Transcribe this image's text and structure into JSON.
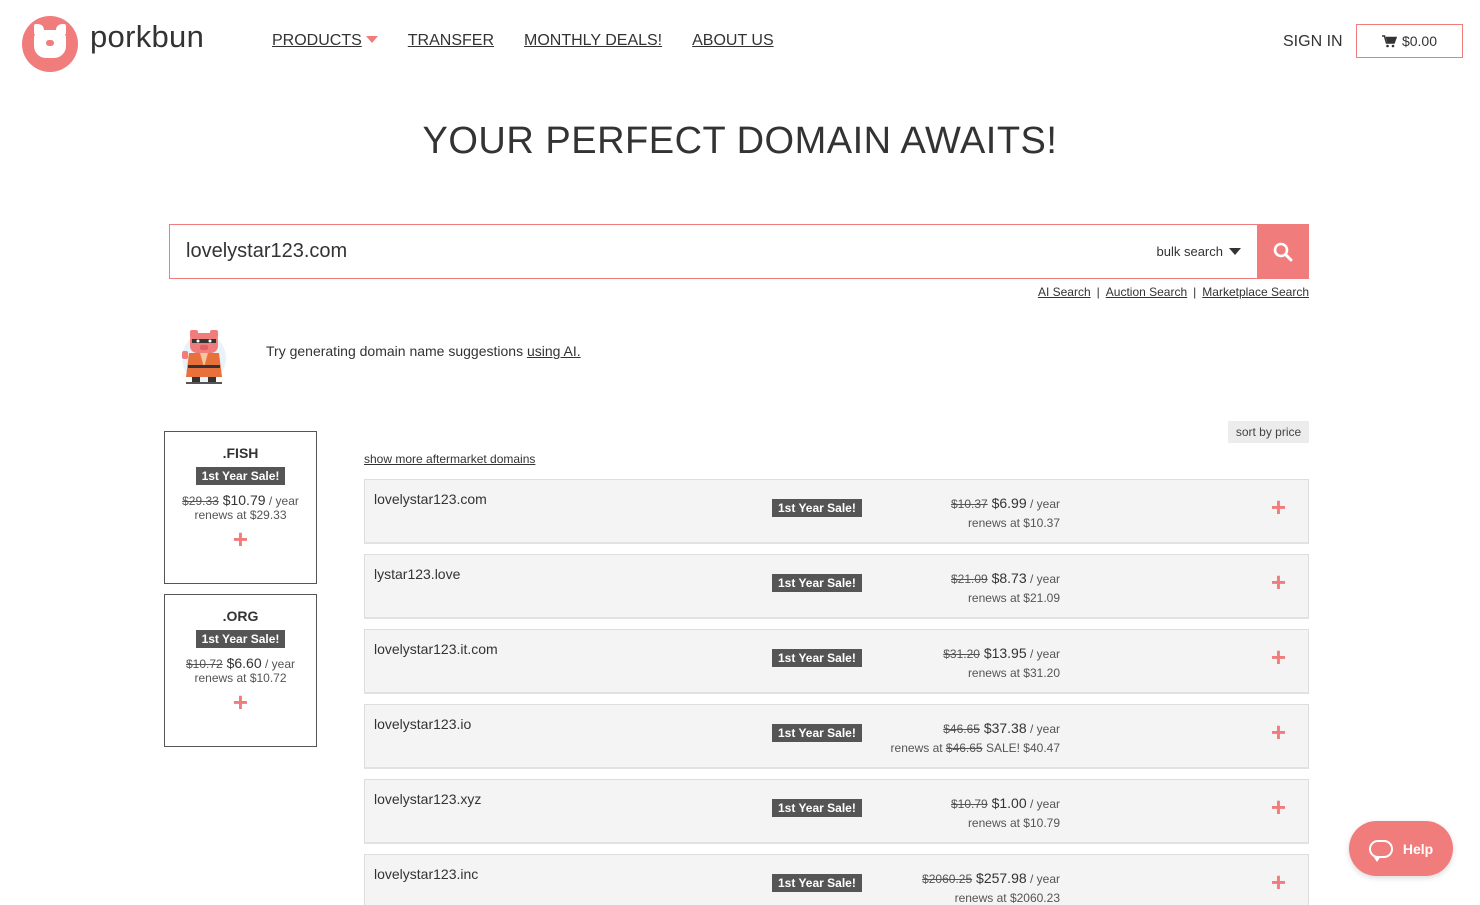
{
  "brand": {
    "name": "porkbun",
    "logo_icon": "pig-icon",
    "accent": "#f07c7c"
  },
  "nav": {
    "products": "PRODUCTS",
    "transfer": "TRANSFER",
    "deals": "MONTHLY DEALS!",
    "about": "ABOUT US"
  },
  "header": {
    "signin": "SIGN IN",
    "cart_total": "$0.00",
    "cart_icon": "cart-icon"
  },
  "hero": {
    "title": "YOUR PERFECT DOMAIN AWAITS!"
  },
  "search": {
    "value": "lovelystar123.com",
    "bulk_label": "bulk search",
    "search_icon": "search-icon"
  },
  "search_links": {
    "ai": "AI Search",
    "auction": "Auction Search",
    "marketplace": "Marketplace Search",
    "separator": "|"
  },
  "ai_suggest": {
    "text": "Try generating domain name suggestions ",
    "link": "using AI."
  },
  "side_cards": [
    {
      "tld": ".FISH",
      "badge": "1st Year Sale!",
      "old_price": "$29.33",
      "price": "$10.79",
      "per": " / year",
      "renew": "renews at $29.33",
      "add": "+"
    },
    {
      "tld": ".ORG",
      "badge": "1st Year Sale!",
      "old_price": "$10.72",
      "price": "$6.60",
      "per": " / year",
      "renew": "renews at $10.72",
      "add": "+"
    }
  ],
  "results": {
    "sort_label": "sort by price",
    "more_link": "show more aftermarket domains",
    "rows": [
      {
        "domain": "lovelystar123.com",
        "badge": "1st Year Sale!",
        "old_price": "$10.37",
        "price": "$6.99",
        "per": " / year",
        "renew_prefix": "renews at ",
        "renew_old": "",
        "renew_value": "$10.37",
        "add": "+"
      },
      {
        "domain": "lystar123.love",
        "badge": "1st Year Sale!",
        "old_price": "$21.09",
        "price": "$8.73",
        "per": " / year",
        "renew_prefix": "renews at ",
        "renew_old": "",
        "renew_value": "$21.09",
        "add": "+"
      },
      {
        "domain": "lovelystar123.it.com",
        "badge": "1st Year Sale!",
        "old_price": "$31.20",
        "price": "$13.95",
        "per": " / year",
        "renew_prefix": "renews at ",
        "renew_old": "",
        "renew_value": "$31.20",
        "add": "+"
      },
      {
        "domain": "lovelystar123.io",
        "badge": "1st Year Sale!",
        "old_price": "$46.65",
        "price": "$37.38",
        "per": " / year",
        "renew_prefix": "renews at ",
        "renew_old": "$46.65",
        "renew_value": " SALE! $40.47",
        "add": "+"
      },
      {
        "domain": "lovelystar123.xyz",
        "badge": "1st Year Sale!",
        "old_price": "$10.79",
        "price": "$1.00",
        "per": " / year",
        "renew_prefix": "renews at ",
        "renew_old": "",
        "renew_value": "$10.79",
        "add": "+"
      },
      {
        "domain": "lovelystar123.inc",
        "badge": "1st Year Sale!",
        "old_price": "$2060.25",
        "price": "$257.98",
        "per": " / year",
        "renew_prefix": "renews at ",
        "renew_old": "",
        "renew_value": "$2060.23",
        "add": "+"
      }
    ]
  },
  "help": {
    "label": "Help",
    "icon": "chat-bubble-icon"
  }
}
